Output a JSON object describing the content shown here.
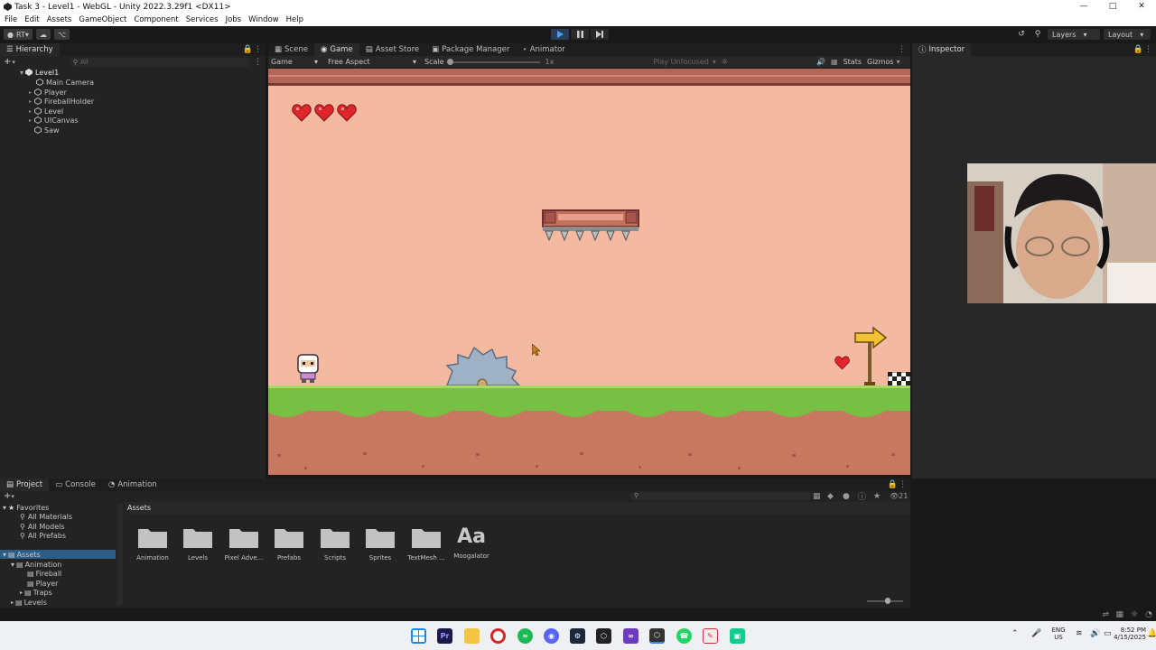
{
  "window": {
    "title": "Task 3 - Level1 - WebGL - Unity 2022.3.29f1 <DX11>",
    "icon": "unity-icon"
  },
  "menu": [
    "File",
    "Edit",
    "Assets",
    "GameObject",
    "Component",
    "Services",
    "Jobs",
    "Window",
    "Help"
  ],
  "toolbar": {
    "account_label": "RT",
    "layers_label": "Layers",
    "layout_label": "Layout"
  },
  "hierarchy": {
    "tab": "Hierarchy",
    "search_placeholder": "All",
    "scene": "Level1",
    "items": [
      "Main Camera",
      "Player",
      "FireballHolder",
      "Level",
      "UICanvas",
      "Saw"
    ]
  },
  "center_tabs": [
    "Scene",
    "Game",
    "Asset Store",
    "Package Manager",
    "Animator"
  ],
  "game_toolbar": {
    "display": "Game",
    "aspect": "Free Aspect",
    "scale_label": "Scale",
    "scale_value": "1x",
    "play_mode": "Play Unfocused",
    "stats": "Stats",
    "gizmos": "Gizmos"
  },
  "inspector": {
    "tab": "Inspector"
  },
  "game_scene": {
    "hearts_hud": 3,
    "colors": {
      "sky": "#f4b9a1",
      "grass": "#77c043",
      "dirt": "#c87761",
      "heart": "#e0262a"
    }
  },
  "bottom_tabs": [
    "Project",
    "Console",
    "Animation"
  ],
  "project": {
    "favorites_label": "Favorites",
    "favorites": [
      "All Materials",
      "All Models",
      "All Prefabs"
    ],
    "assets_root": "Assets",
    "tree": [
      "Animation",
      "Fireball",
      "Player",
      "Traps",
      "Levels"
    ],
    "breadcrumb": "Assets",
    "asset_count": "21",
    "items": [
      "Animation",
      "Levels",
      "Pixel Adve...",
      "Prefabs",
      "Scripts",
      "Sprites",
      "TextMesh ...",
      "Moogalator"
    ],
    "font_glyph": "Aa"
  },
  "system_tray": {
    "lang1": "ENG",
    "lang2": "US",
    "time": "8:52 PM",
    "date": "4/15/2025"
  }
}
